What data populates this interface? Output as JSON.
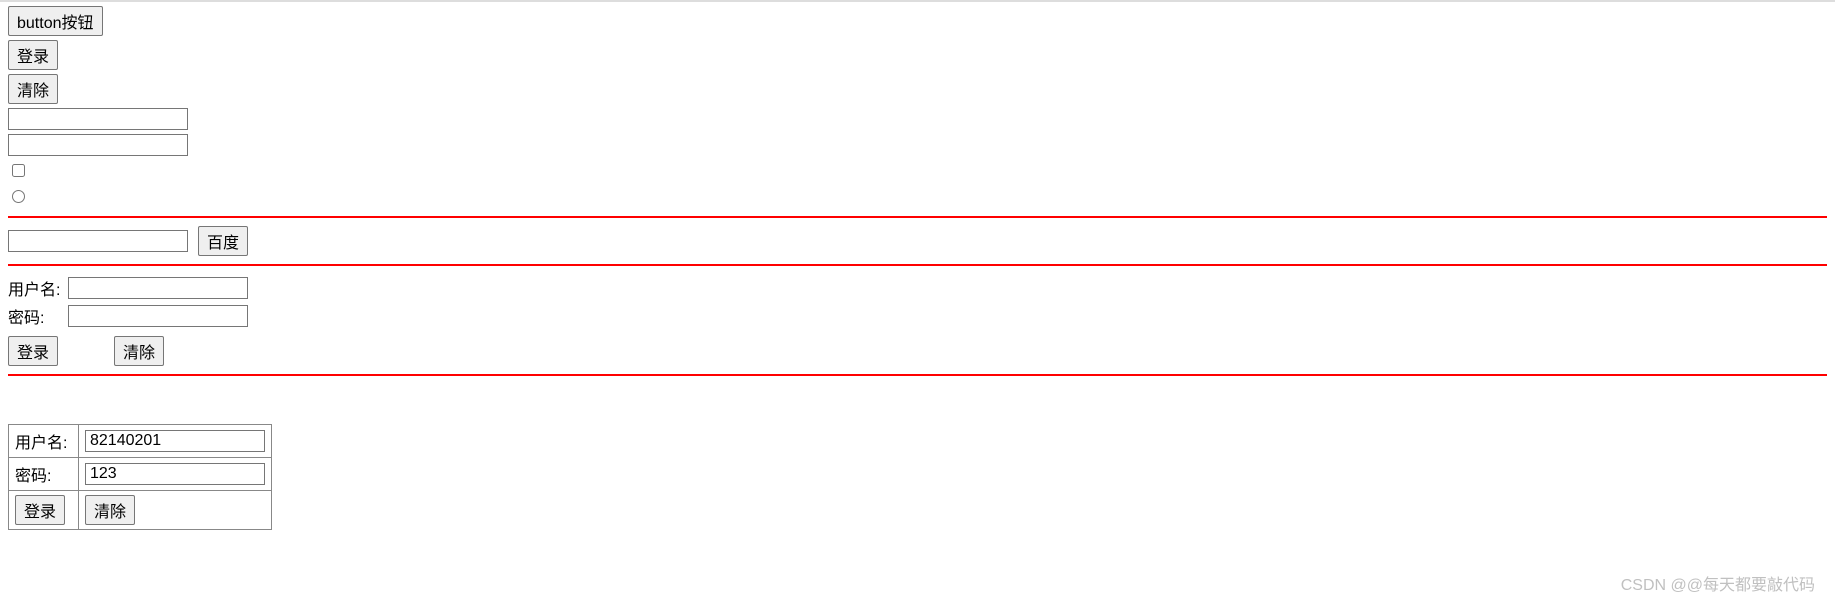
{
  "section1": {
    "button_label": "button按钮",
    "login_label": "登录",
    "clear_label": "清除",
    "text1_value": "",
    "text2_value": "",
    "checkbox_checked": false,
    "radio_checked": false
  },
  "baidu_section": {
    "input_value": "",
    "button_label": "百度"
  },
  "form1": {
    "username_label": "用户名:",
    "username_value": "",
    "password_label": "密码:",
    "password_value": "",
    "login_label": "登录",
    "clear_label": "清除"
  },
  "form2": {
    "username_label": "用户名:",
    "username_value": "82140201",
    "password_label": "密码:",
    "password_value": "123",
    "login_label": "登录",
    "clear_label": "清除"
  },
  "watermark": "CSDN @@每天都要敲代码"
}
